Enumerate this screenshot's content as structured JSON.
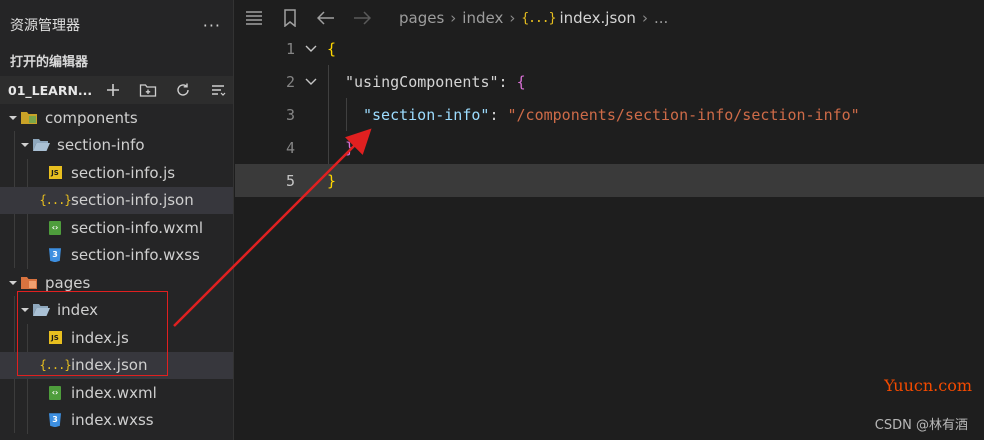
{
  "sidebar": {
    "title": "资源管理器",
    "more": "···",
    "open_editors": "打开的编辑器",
    "project": "01_LEARN...",
    "tree": {
      "components": "components",
      "section_info_folder": "section-info",
      "files_component": [
        "section-info.js",
        "section-info.json",
        "section-info.wxml",
        "section-info.wxss"
      ],
      "pages": "pages",
      "index_folder": "index",
      "files_index": [
        "index.js",
        "index.json",
        "index.wxml",
        "index.wxss"
      ]
    },
    "icon_labels": {
      "js": "JS",
      "json": "{...}",
      "css": "3"
    }
  },
  "editor": {
    "breadcrumb": [
      "pages",
      "index",
      "index.json",
      "..."
    ],
    "lines": {
      "l1": "{",
      "l2_key": "\"usingComponents\"",
      "l2_colon": ": ",
      "l2_brace": "{",
      "l3_key": "\"section-info\"",
      "l3_colon": ": ",
      "l3_val": "\"/components/section-info/section-info\"",
      "l4": "}",
      "l5": "}"
    },
    "line_numbers": [
      "1",
      "2",
      "3",
      "4",
      "5"
    ]
  },
  "watermark": {
    "site": "Yuucn.com",
    "credit": "CSDN @林有酒"
  },
  "colors": {
    "annotation_red": "#e02020",
    "json_key": "#9cdcfe",
    "json_string": "#ce6b48"
  }
}
